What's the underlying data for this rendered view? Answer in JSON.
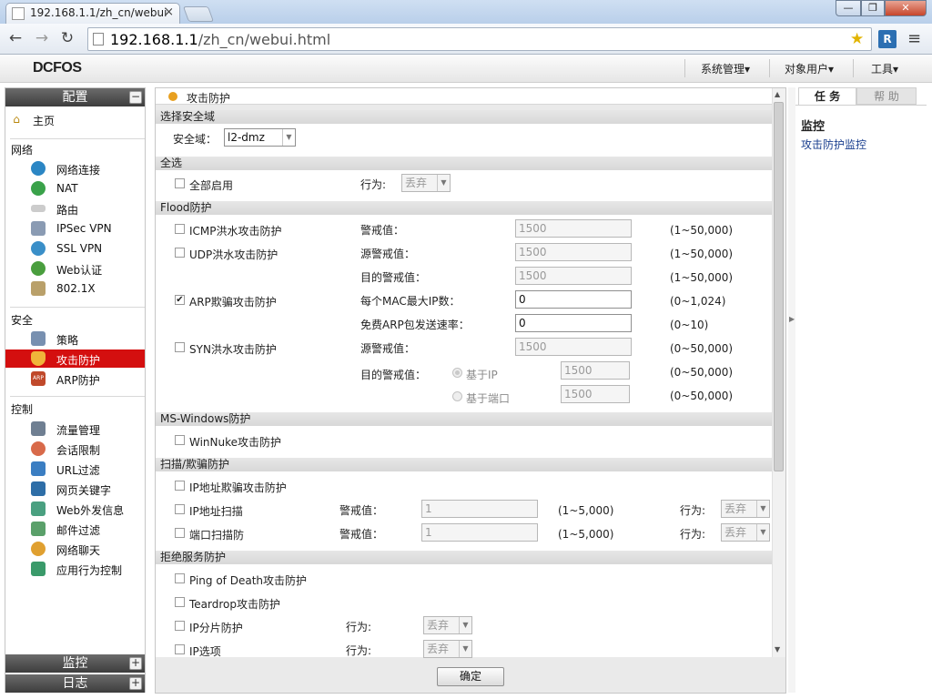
{
  "browser": {
    "tab_title": "192.168.1.1/zh_cn/webui",
    "tab_close": "×",
    "url_host": "192.168.1.1",
    "url_path": "/zh_cn/webui.html",
    "min": "—",
    "max": "❐",
    "close": "✕",
    "back": "←",
    "forward": "→",
    "reload": "↻",
    "star": "★",
    "ext": "R",
    "menu": "≡"
  },
  "header": {
    "logo": "DCFOS",
    "menus": [
      "系统管理▾",
      "对象用户▾",
      "工具▾"
    ]
  },
  "sidebar": {
    "config_title": "配置",
    "config_toggle": "−",
    "home": "主页",
    "network_label": "网络",
    "network_items": [
      "网络连接",
      "NAT",
      "路由",
      "IPSec VPN",
      "SSL VPN",
      "Web认证",
      "802.1X"
    ],
    "security_label": "安全",
    "security_items": [
      "策略",
      "攻击防护",
      "ARP防护"
    ],
    "control_label": "控制",
    "control_items": [
      "流量管理",
      "会话限制",
      "URL过滤",
      "网页关键字",
      "Web外发信息",
      "邮件过滤",
      "网络聊天",
      "应用行为控制"
    ],
    "monitor_title": "监控",
    "log_title": "日志",
    "plus": "+"
  },
  "main": {
    "title": "攻击防护",
    "zone_section": "选择安全域",
    "zone_label": "安全域：",
    "zone_value": "l2-dmz",
    "all_section": "全选",
    "all_enable": "全部启用",
    "action_label": "行为:",
    "action_value": "丢弃",
    "flood_section": "Flood防护",
    "icmp": "ICMP洪水攻击防护",
    "udp": "UDP洪水攻击防护",
    "arp": "ARP欺骗攻击防护",
    "syn": "SYN洪水攻击防护",
    "warn": "警戒值：",
    "src_warn": "源警戒值：",
    "dst_warn": "目的警戒值：",
    "max_ip": "每个MAC最大IP数：",
    "arp_rate": "免费ARP包发送速率：",
    "by_ip": "基于IP",
    "by_port": "基于端口",
    "v1500": "1500",
    "v0": "0",
    "v1": "1",
    "range_50000a": "(1~50,000)",
    "range_1024": "(0~1,024)",
    "range_10": "(0~10)",
    "range_50000b": "(0~50,000)",
    "range_5000": "(1~5,000)",
    "ms_section": "MS-Windows防护",
    "winnuke": "WinNuke攻击防护",
    "scan_section": "扫描/欺骗防护",
    "ip_spoof": "IP地址欺骗攻击防护",
    "ip_scan": "IP地址扫描",
    "port_scan": "端口扫描防",
    "warn2": "警戒值：",
    "action2": "行为:",
    "dos_section": "拒绝服务防护",
    "ping_death": "Ping of Death攻击防护",
    "teardrop": "Teardrop攻击防护",
    "ip_frag": "IP分片防护",
    "ip_opt": "IP选项",
    "ok": "确定"
  },
  "right": {
    "tab_task": "任 务",
    "tab_help": "帮 助",
    "monitor_title": "监控",
    "monitor_link": "攻击防护监控"
  }
}
